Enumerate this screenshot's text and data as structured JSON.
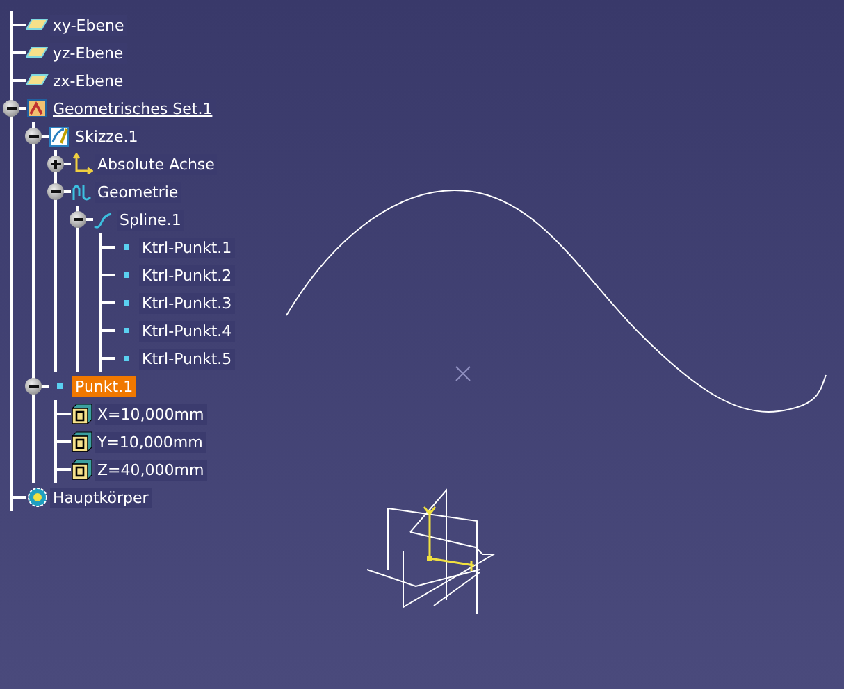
{
  "tree": [
    {
      "label": "xy-Ebene",
      "kind": "plane",
      "selected": false,
      "active": false
    },
    {
      "label": "yz-Ebene",
      "kind": "plane",
      "selected": false,
      "active": false
    },
    {
      "label": "zx-Ebene",
      "kind": "plane",
      "selected": false,
      "active": false
    },
    {
      "label": "Geometrisches Set.1",
      "kind": "geoset",
      "selected": false,
      "active": true,
      "expanded": true,
      "children": [
        {
          "label": "Skizze.1",
          "kind": "sketch",
          "selected": false,
          "active": false,
          "expanded": true,
          "children": [
            {
              "label": "Absolute Achse",
              "kind": "axis",
              "selected": false,
              "active": false,
              "expanded": false
            },
            {
              "label": "Geometrie",
              "kind": "geometry",
              "selected": false,
              "active": false,
              "expanded": true,
              "children": [
                {
                  "label": "Spline.1",
                  "kind": "spline",
                  "selected": false,
                  "active": false,
                  "expanded": true,
                  "children": [
                    {
                      "label": "Ktrl-Punkt.1",
                      "kind": "point",
                      "selected": false,
                      "active": false
                    },
                    {
                      "label": "Ktrl-Punkt.2",
                      "kind": "point",
                      "selected": false,
                      "active": false
                    },
                    {
                      "label": "Ktrl-Punkt.3",
                      "kind": "point",
                      "selected": false,
                      "active": false
                    },
                    {
                      "label": "Ktrl-Punkt.4",
                      "kind": "point",
                      "selected": false,
                      "active": false
                    },
                    {
                      "label": "Ktrl-Punkt.5",
                      "kind": "point",
                      "selected": false,
                      "active": false
                    }
                  ]
                }
              ]
            }
          ]
        },
        {
          "label": "Punkt.1",
          "kind": "point",
          "selected": true,
          "active": false,
          "expanded": true,
          "children": [
            {
              "label": "X=10,000mm",
              "kind": "parameter",
              "selected": false,
              "active": false
            },
            {
              "label": "Y=10,000mm",
              "kind": "parameter",
              "selected": false,
              "active": false
            },
            {
              "label": "Z=40,000mm",
              "kind": "parameter",
              "selected": false,
              "active": false
            }
          ]
        }
      ]
    },
    {
      "label": "Hauptkörper",
      "kind": "body",
      "selected": false,
      "active": false
    }
  ]
}
